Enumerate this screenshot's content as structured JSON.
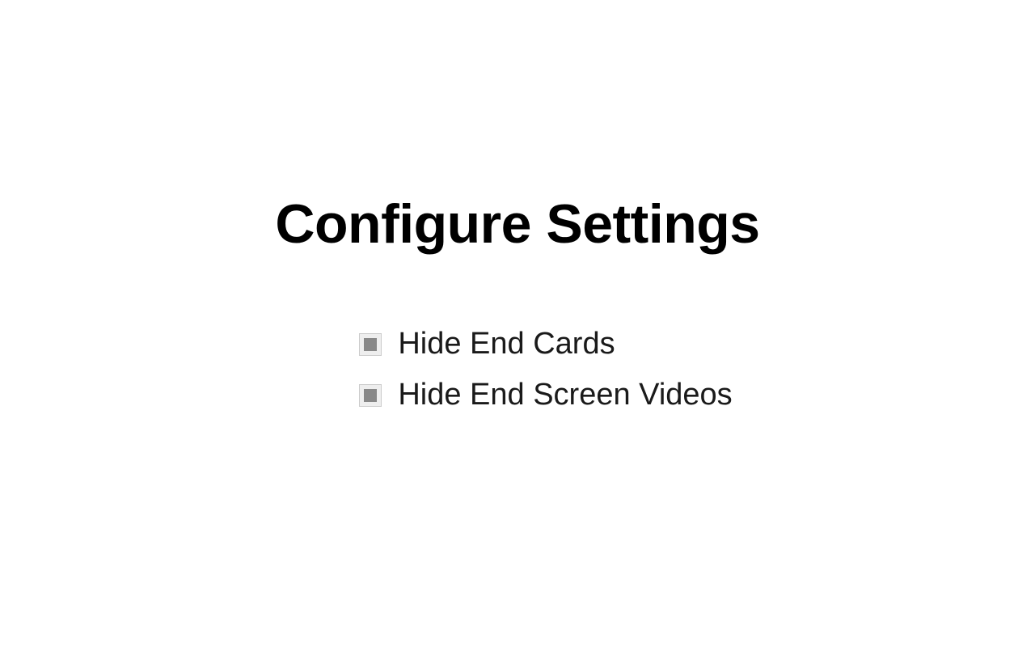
{
  "title": "Configure Settings",
  "options": [
    {
      "label": "Hide End Cards"
    },
    {
      "label": "Hide End Screen Videos"
    }
  ]
}
